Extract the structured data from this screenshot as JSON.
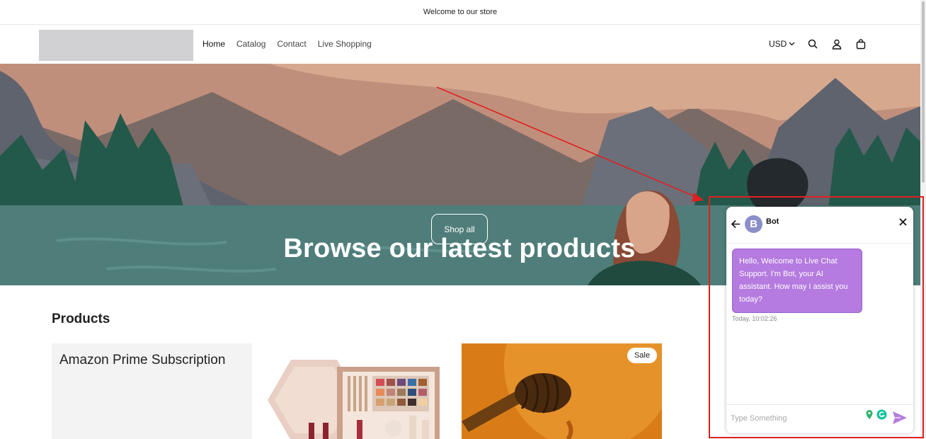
{
  "announcement": {
    "text": "Welcome to our store"
  },
  "nav": {
    "items": [
      "Home",
      "Catalog",
      "Contact",
      "Live Shopping"
    ]
  },
  "header": {
    "currency": "USD"
  },
  "hero": {
    "title": "Browse our latest products",
    "button_label": "Shop all"
  },
  "products": {
    "heading": "Products",
    "cards": [
      {
        "name": "Amazon Prime Subscription"
      },
      {
        "name": ""
      },
      {
        "badge": "Sale"
      }
    ]
  },
  "chat": {
    "bot_name": "Bot",
    "avatar_letter": "B",
    "message": "Hello, Welcome to Live Chat Support. I'm Bot, your AI assistant. How may I assist you today?",
    "timestamp": "Today, 10:02:26",
    "input_placeholder": "Type Something"
  },
  "colors": {
    "hero_water": "#4f7d7a",
    "bubble": "#b57be0",
    "highlight": "#e02020"
  }
}
